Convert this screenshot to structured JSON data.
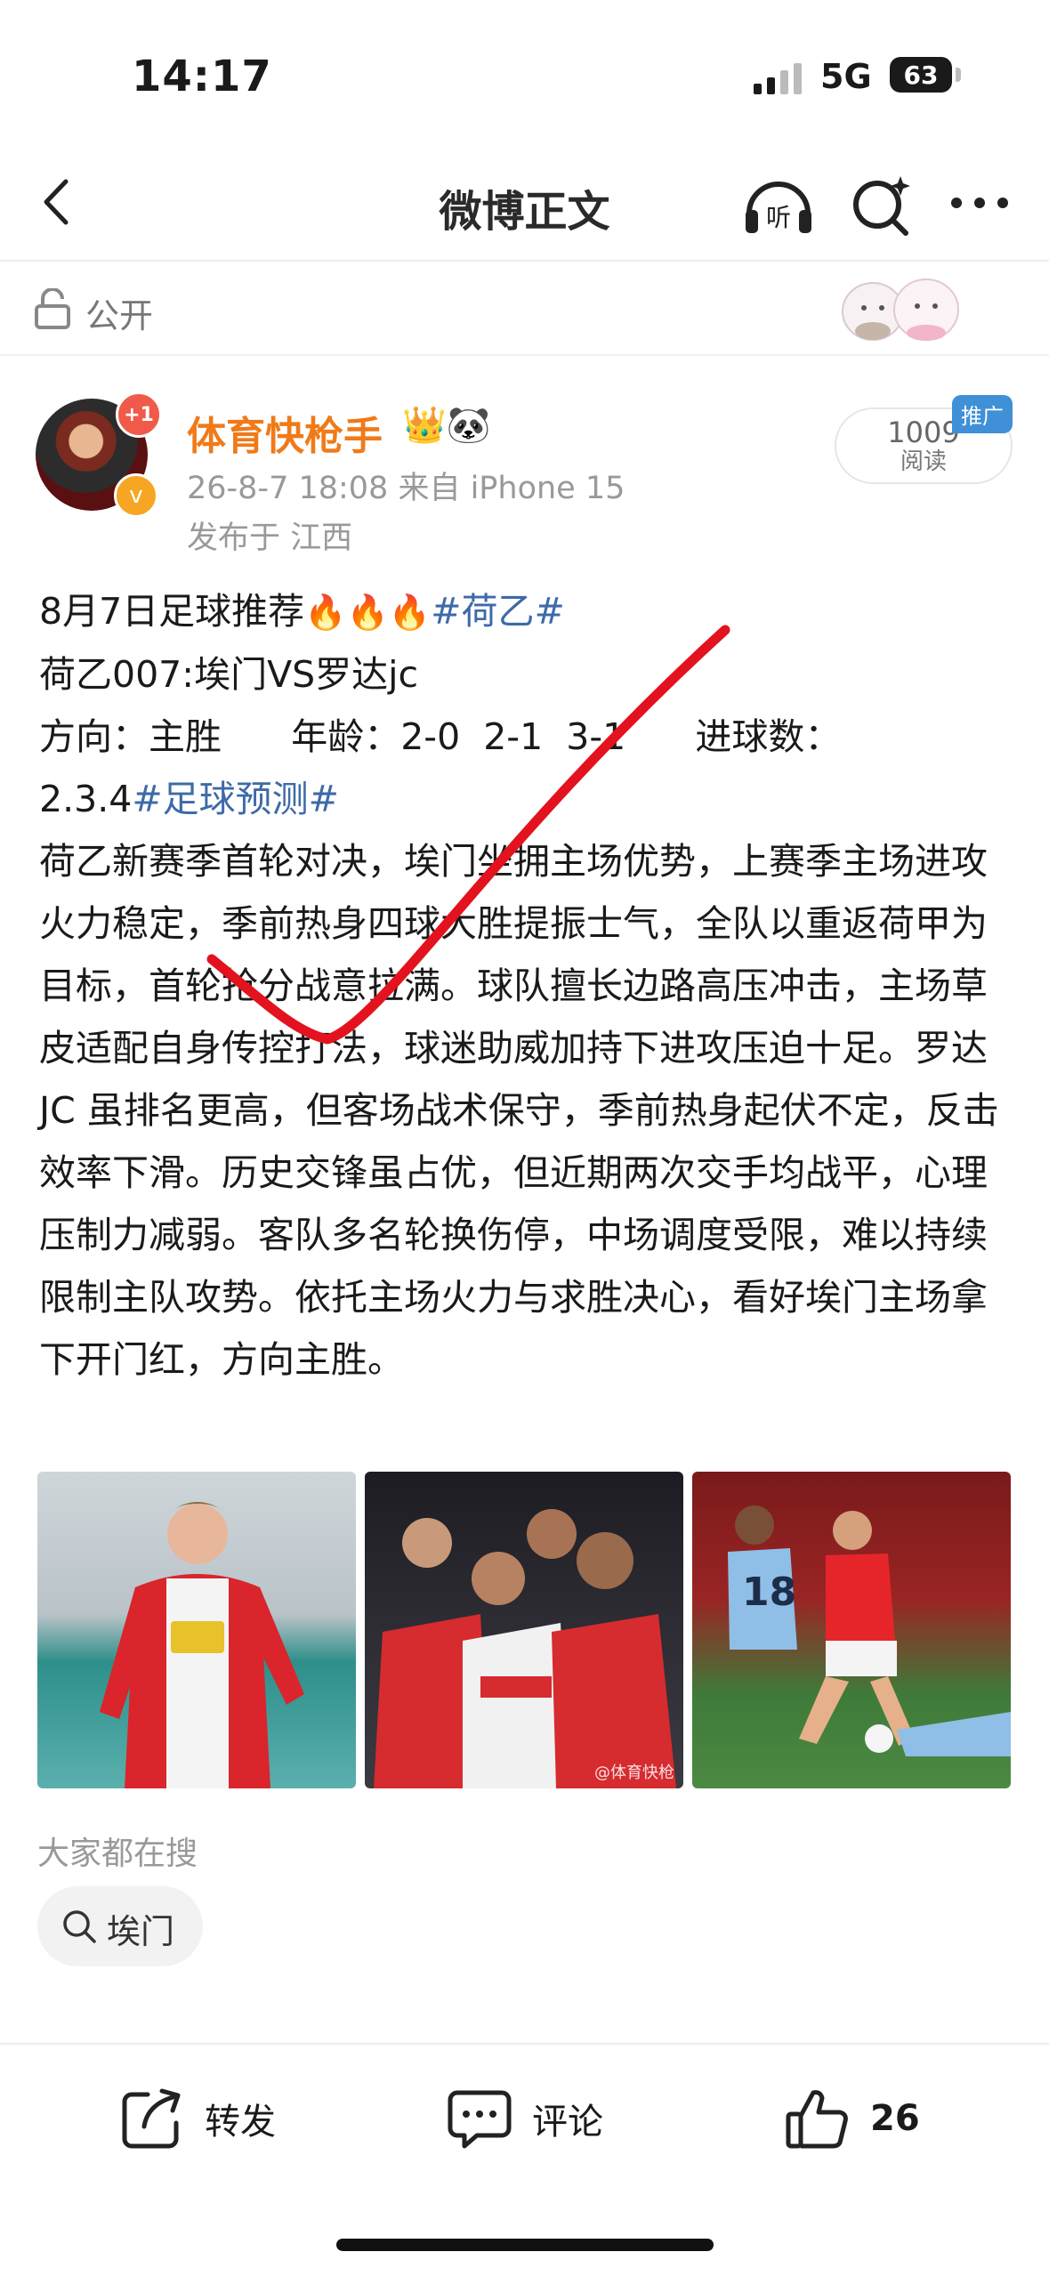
{
  "status": {
    "time": "14:17",
    "network": "5G",
    "battery": "63"
  },
  "nav": {
    "title": "微博正文",
    "listen_icon": "headphone-icon",
    "listen_label": "听",
    "search_icon": "search-sparkle-icon",
    "more_icon": "more-dots-icon"
  },
  "visibility": {
    "label": "公开",
    "icon": "lock-icon"
  },
  "post": {
    "author": "体育快枪手",
    "author_emoji": "👑🐼",
    "avatar_badge": "+1",
    "time_source": "26-8-7 18:08  来自 iPhone 15",
    "location": "发布于 江西",
    "reads_count": "1009",
    "reads_label": "阅读",
    "promo_tag": "推广",
    "line1_text": "8月7日足球推荐",
    "line1_fire": "🔥🔥🔥",
    "line1_tag": "#荷乙#",
    "line2": "荷乙007:埃门VS罗达jc",
    "line3": "方向：主胜      年龄：2-0  2-1  3-1      进球数：",
    "line4_text": "2.3.4",
    "line4_tag": "#足球预测#",
    "body": "荷乙新赛季首轮对决，埃门坐拥主场优势，上赛季主场进攻火力稳定，季前热身四球大胜提振士气，全队以重返荷甲为目标，首轮抢分战意拉满。球队擅长边路高压冲击，主场草皮适配自身传控打法，球迷助威加持下进攻压迫十足。罗达 JC 虽排名更高，但客场战术保守，季前热身起伏不定，反击效率下滑。历史交锋虽占优，但近期两次交手均战平，心理压制力减弱。客队多名轮换伤停，中场调度受限，难以持续限制主队攻势。依托主场火力与求胜决心，看好埃门主场拿下开门红，方向主胜。",
    "photo_watermark": "@体育快枪"
  },
  "suggest": {
    "title": "大家都在搜",
    "chip": "埃门"
  },
  "actions": {
    "repost": "转发",
    "comment": "评论",
    "like_count": "26"
  },
  "colors": {
    "author": "#f07a18",
    "tag": "#3e6aa8",
    "annotation": "#e3121f"
  }
}
